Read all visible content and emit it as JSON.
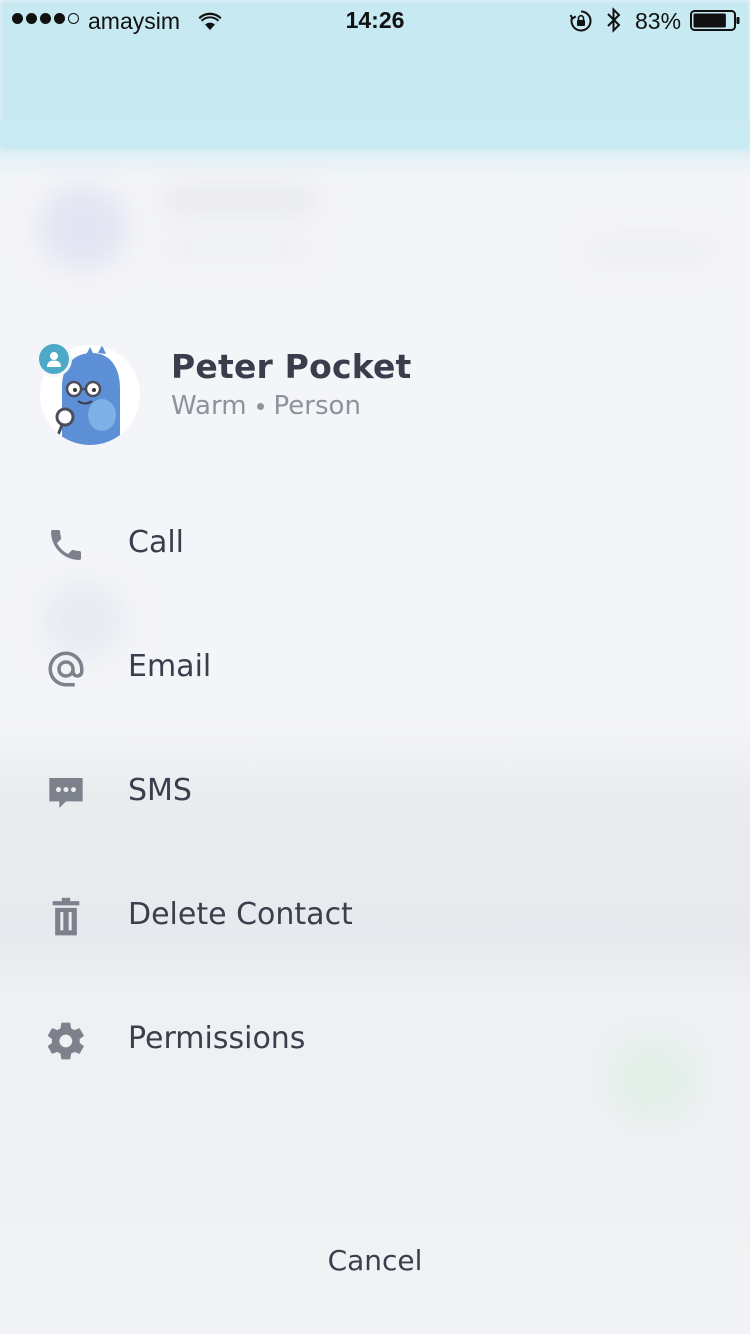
{
  "status_bar": {
    "signal_bars_filled": 4,
    "signal_bars_total": 5,
    "carrier": "amaysim",
    "time": "14:26",
    "battery_percent": "83%",
    "battery_level": 0.83,
    "icons": [
      "wifi-icon",
      "rotation-lock-icon",
      "bluetooth-icon",
      "battery-icon"
    ]
  },
  "contact": {
    "name": "Peter Pocket",
    "status": "Warm",
    "type": "Person",
    "avatar_icon": "blue-monster-avatar",
    "badge_icon": "person-icon",
    "badge_color": "#4da9c8"
  },
  "actions": [
    {
      "label": "Call",
      "icon": "phone-icon"
    },
    {
      "label": "Email",
      "icon": "at-icon"
    },
    {
      "label": "SMS",
      "icon": "chat-icon"
    },
    {
      "label": "Delete Contact",
      "icon": "trash-icon"
    },
    {
      "label": "Permissions",
      "icon": "gear-icon"
    }
  ],
  "cancel_label": "Cancel",
  "colors": {
    "text_primary": "#3b3e4c",
    "text_secondary": "#8e929c",
    "icon_gray": "#7d818c",
    "header_blue": "#c7e9f1",
    "sheet_bg": "#f4f5f8"
  }
}
